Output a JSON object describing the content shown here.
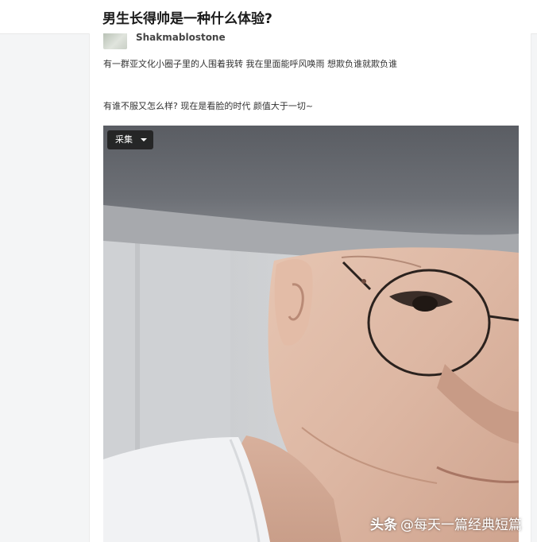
{
  "header": {
    "question_title": "男生长得帅是一种什么体验?"
  },
  "answer": {
    "author": "Shakmablostone",
    "paragraphs": [
      "有一群亚文化小圈子里的人围着我转 我在里面能呼风唤雨 想欺负谁就欺负谁",
      "有谁不服又怎么样? 现在是看脸的时代 颜值大于一切~"
    ]
  },
  "image_overlay": {
    "collect_button_label": "采集",
    "watermark_brand": "头条",
    "watermark_account": "@每天一篇经典短篇"
  },
  "colors": {
    "page_background": "#f4f5f6",
    "title_text": "#1a1a1a",
    "body_text": "#333333",
    "button_background": "#1e1e1e"
  },
  "icons": {
    "collect_dropdown": "chevron-down-icon"
  }
}
